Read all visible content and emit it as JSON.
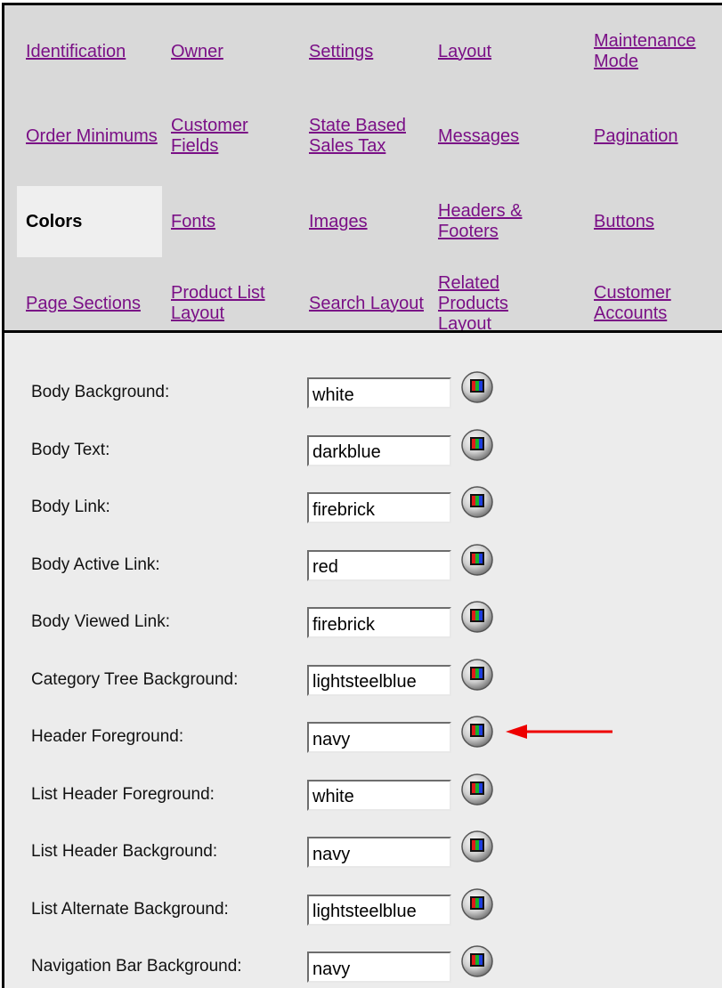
{
  "tabs": [
    {
      "label": "Identification",
      "active": false
    },
    {
      "label": "Owner",
      "active": false
    },
    {
      "label": "Settings",
      "active": false
    },
    {
      "label": "Layout",
      "active": false
    },
    {
      "label": "Maintenance Mode",
      "active": false
    },
    {
      "label": "Order Minimums",
      "active": false
    },
    {
      "label": "Customer Fields",
      "active": false
    },
    {
      "label": "State Based Sales Tax",
      "active": false
    },
    {
      "label": "Messages",
      "active": false
    },
    {
      "label": "Pagination",
      "active": false
    },
    {
      "label": "Colors",
      "active": true
    },
    {
      "label": "Fonts",
      "active": false
    },
    {
      "label": "Images",
      "active": false
    },
    {
      "label": "Headers & Footers",
      "active": false
    },
    {
      "label": "Buttons",
      "active": false
    },
    {
      "label": "Page Sections",
      "active": false
    },
    {
      "label": "Product List Layout",
      "active": false
    },
    {
      "label": "Search Layout",
      "active": false
    },
    {
      "label": "Related Products Layout",
      "active": false
    },
    {
      "label": "Customer Accounts",
      "active": false
    }
  ],
  "colors": {
    "link": "#7a0f86",
    "tab_background": "#d9d9d9",
    "active_tab_background": "#efefef",
    "panel_background": "#ececec",
    "annotation_arrow": "#ee0000"
  },
  "rows": [
    {
      "label": "Body Background:",
      "value": "white"
    },
    {
      "label": "Body Text:",
      "value": "darkblue"
    },
    {
      "label": "Body Link:",
      "value": "firebrick"
    },
    {
      "label": "Body Active Link:",
      "value": "red"
    },
    {
      "label": "Body Viewed Link:",
      "value": "firebrick"
    },
    {
      "label": "Category Tree Background:",
      "value": "lightsteelblue"
    },
    {
      "label": "Header Foreground:",
      "value": "navy"
    },
    {
      "label": "List Header Foreground:",
      "value": "white"
    },
    {
      "label": "List Header Background:",
      "value": "navy"
    },
    {
      "label": "List Alternate Background:",
      "value": "lightsteelblue"
    },
    {
      "label": "Navigation Bar Background:",
      "value": "navy"
    }
  ],
  "picker_icon": "color-picker-icon",
  "annotation": {
    "points_to_row": "Header Foreground:"
  }
}
